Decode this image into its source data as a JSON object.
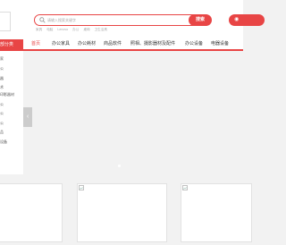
{
  "search": {
    "placeholder": "请输入搜索关键字",
    "button_label": "搜索",
    "hot_words": [
      "家具",
      "电脑",
      "Lenovo",
      "办公",
      "桌椅",
      "卫生洁具"
    ]
  },
  "sidebar": {
    "title": "全部分类",
    "items": [
      "家",
      "公",
      "器",
      "术",
      "印影器材",
      "公",
      "公",
      "公",
      "品",
      "设备"
    ]
  },
  "nav": {
    "items": [
      "首页",
      "办公家具",
      "办公耗材",
      "商品软件",
      "照相、摄影器材及配件",
      "办公设备",
      "电器设备"
    ]
  },
  "banner": {
    "arrow_glyph": "‹"
  },
  "header": {
    "right_glyph": "◉"
  },
  "colors": {
    "accent": "#e84545",
    "background": "#f2f2f2"
  }
}
